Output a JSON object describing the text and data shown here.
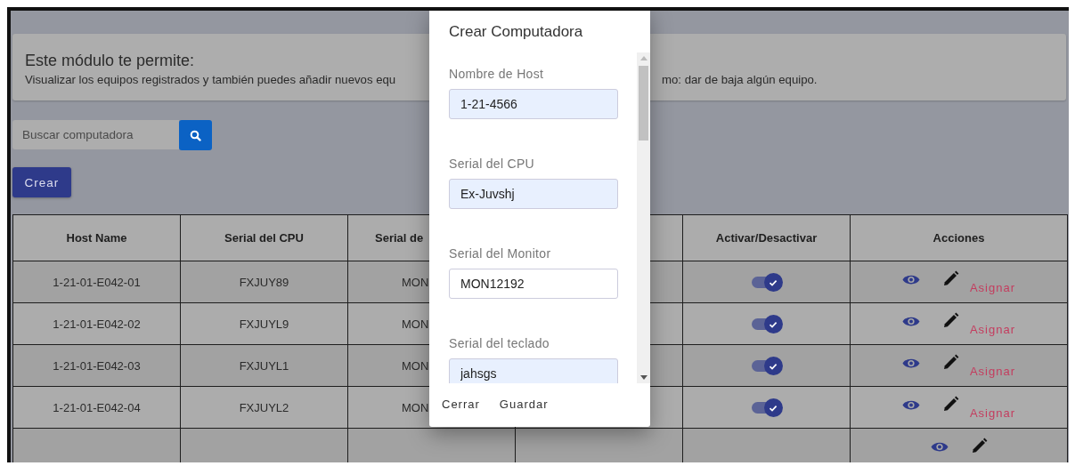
{
  "info_card": {
    "title": "Este módulo te permite:",
    "description_parts": [
      "Visualizar los equipos registrados y también puedes añadir nuevos equ",
      "mo: dar de baja algún equipo."
    ]
  },
  "search": {
    "placeholder": "Buscar computadora"
  },
  "create_button": "Crear",
  "table": {
    "columns": [
      {
        "kind": "text",
        "label": "Host Name"
      },
      {
        "kind": "text",
        "label": "Serial del CPU"
      },
      {
        "kind": "covered",
        "label": "Serial de"
      },
      {
        "kind": "hidden"
      },
      {
        "kind": "toggle",
        "label": "Activar/Desactivar"
      },
      {
        "kind": "actions",
        "label": "Acciones"
      }
    ],
    "rows": [
      {
        "host": "1-21-01-E042-01",
        "cpu": "FXJUY89",
        "monitor": "MON",
        "active": true,
        "assign": "Asignar"
      },
      {
        "host": "1-21-01-E042-02",
        "cpu": "FXJUYL9",
        "monitor": "MON",
        "active": true,
        "assign": "Asignar"
      },
      {
        "host": "1-21-01-E042-03",
        "cpu": "FXJUYL1",
        "monitor": "MON",
        "active": true,
        "assign": "Asignar"
      },
      {
        "host": "1-21-01-E042-04",
        "cpu": "FXJUYL2",
        "monitor": "MON",
        "active": true,
        "assign": "Asignar"
      },
      {}
    ]
  },
  "dialog": {
    "title": "Crear Computadora",
    "fields": [
      {
        "label": "Nombre de Host",
        "value": "1-21-4566",
        "autofilled": true
      },
      {
        "label": "Serial del CPU",
        "value": "Ex-Juvshj",
        "autofilled": true
      },
      {
        "label": "Serial del Monitor",
        "value": "MON12192",
        "autofilled": false
      },
      {
        "label": "Serial del teclado",
        "value": "jahsgs",
        "autofilled": true
      }
    ],
    "buttons": [
      "Cerrar",
      "Guardar"
    ]
  }
}
